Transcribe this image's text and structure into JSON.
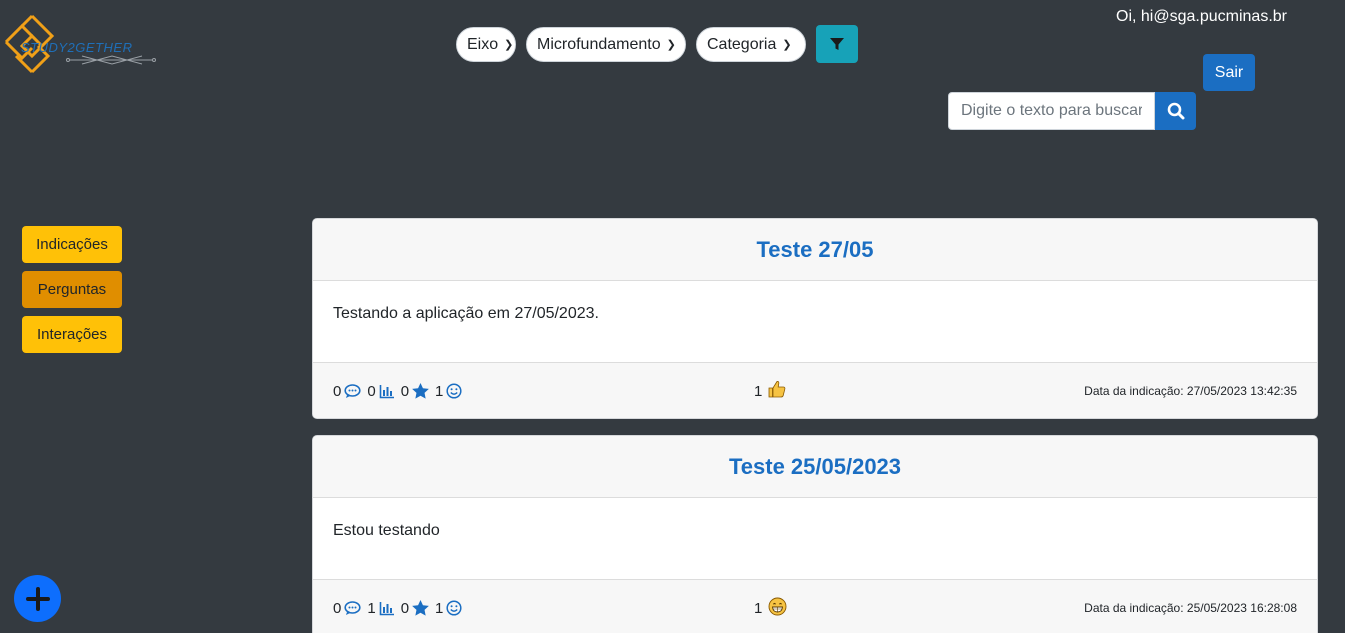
{
  "brand": {
    "logo_text": "STUDY2GETHER"
  },
  "filters": {
    "eixo": "Eixo",
    "microfundamento": "Microfundamento",
    "categoria": "Categoria"
  },
  "header": {
    "greeting": "Oi, hi@sga.pucminas.br",
    "logout_label": "Sair",
    "search_placeholder": "Digite o texto para buscar"
  },
  "sidebar": {
    "items": [
      {
        "label": "Indicações",
        "active": false
      },
      {
        "label": "Perguntas",
        "active": true
      },
      {
        "label": "Interações",
        "active": false
      }
    ]
  },
  "colors": {
    "background": "#343a40",
    "primary": "#1b6ec2",
    "warning": "#ffc107",
    "warning_active": "#e08e00",
    "info": "#17a2b8"
  },
  "posts": [
    {
      "title": "Teste 27/05",
      "body": "Testando a aplicação em 27/05/2023.",
      "comments": "0",
      "stats": "0",
      "stars": "0",
      "smiles": "1",
      "reaction_count": "1",
      "reaction_icon": "thumbs-up-icon",
      "date": "Data da indicação: 27/05/2023 13:42:35"
    },
    {
      "title": "Teste 25/05/2023",
      "body": "Estou testando",
      "comments": "0",
      "stats": "1",
      "stars": "0",
      "smiles": "1",
      "reaction_count": "1",
      "reaction_icon": "grin-icon",
      "date": "Data da indicação: 25/05/2023 16:28:08"
    }
  ]
}
